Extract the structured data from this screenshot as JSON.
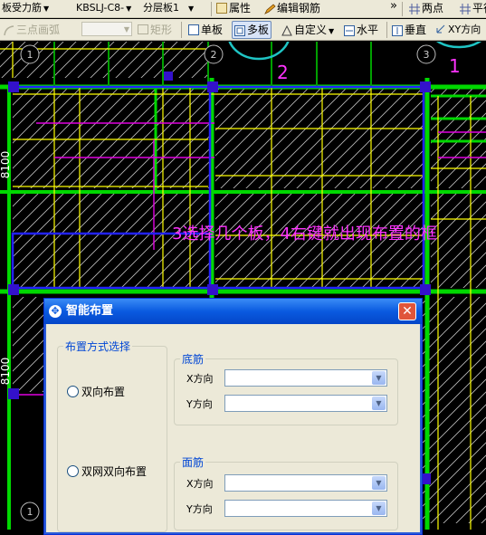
{
  "toolbar1": {
    "combo_type": "板受力筋",
    "combo_name": "KBSLJ-C8-",
    "combo_layer": "分层板1",
    "properties": "属性",
    "edit_rebar": "编辑钢筋",
    "more": "»",
    "two_points": "两点",
    "parallel": "平行"
  },
  "toolbar2": {
    "three_point_arc": "三点画弧",
    "arc_combo_value": "",
    "rectangle": "矩形",
    "single_slab": "单板",
    "multi_slab": "多板",
    "custom": "自定义",
    "horizontal": "水平",
    "vertical": "垂直",
    "xy_direction": "XY方向"
  },
  "canvas": {
    "axis_labels": [
      "1",
      "2",
      "3"
    ],
    "dimension_labels": [
      "8100",
      "8100"
    ],
    "annotations": {
      "step1": "1",
      "step2": "2",
      "step3": "3选择几个板，4右键就出现布置的框"
    },
    "colors": {
      "beam_green": "#00d800",
      "grid_yellow": "#ffff00",
      "rebar_magenta": "#e000e0",
      "slab_blue": "#2222ff",
      "hatch_white": "#cccccc",
      "highlight_circle": "#1fc4c4"
    }
  },
  "dialog": {
    "title": "智能布置",
    "close": "✕",
    "group_mode": {
      "legend": "布置方式选择",
      "options": [
        "双向布置",
        "双网双向布置"
      ],
      "selected": null
    },
    "group_bottom": {
      "legend": "底筋",
      "x_label": "X方向",
      "y_label": "Y方向",
      "x_value": "",
      "y_value": ""
    },
    "group_top": {
      "legend": "面筋",
      "x_label": "X方向",
      "y_label": "Y方向",
      "x_value": "",
      "y_value": ""
    }
  }
}
